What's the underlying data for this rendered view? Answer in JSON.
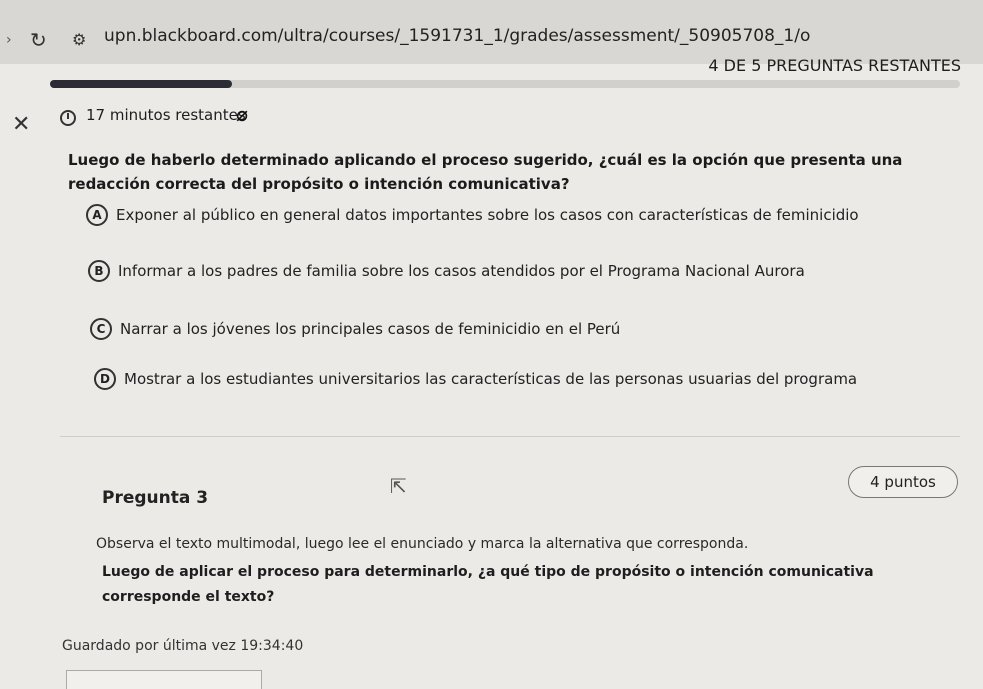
{
  "browser": {
    "url": "upn.blackboard.com/ultra/courses/_1591731_1/grades/assessment/_50905708_1/o"
  },
  "header": {
    "remaining": "4 DE 5 PREGUNTAS RESTANTES",
    "progress_fraction": 0.2,
    "timer": "17 minutos restantes"
  },
  "question2": {
    "text": "Luego de haberlo determinado aplicando el proceso sugerido, ¿cuál es la opción que presenta una redacción correcta del propósito o intención comunicativa?",
    "options": [
      {
        "letter": "A",
        "text": "Exponer al público en general datos importantes sobre los casos con características de feminicidio"
      },
      {
        "letter": "B",
        "text": "Informar a los padres de familia sobre los casos atendidos por el Programa Nacional Aurora"
      },
      {
        "letter": "C",
        "text": "Narrar a los jóvenes los principales casos de feminicidio en el Perú"
      },
      {
        "letter": "D",
        "text": "Mostrar a los estudiantes universitarios las características de las personas usuarias del programa"
      }
    ]
  },
  "question3": {
    "title": "Pregunta 3",
    "points": "4 puntos",
    "instruction": "Observa el texto multimodal, luego lee el enunciado y marca la alternativa que corresponda.",
    "text": "Luego de aplicar el proceso para determinarlo, ¿a qué tipo de propósito o intención comunicativa corresponde el texto?"
  },
  "footer": {
    "saved": "Guardado por última vez 19:34:40"
  },
  "icons": {
    "reload": "reload-icon",
    "site": "site-settings-icon",
    "close": "close-icon",
    "timer": "timer-icon",
    "hide_timer": "hide-timer-icon",
    "cursor": "cursor-icon"
  }
}
